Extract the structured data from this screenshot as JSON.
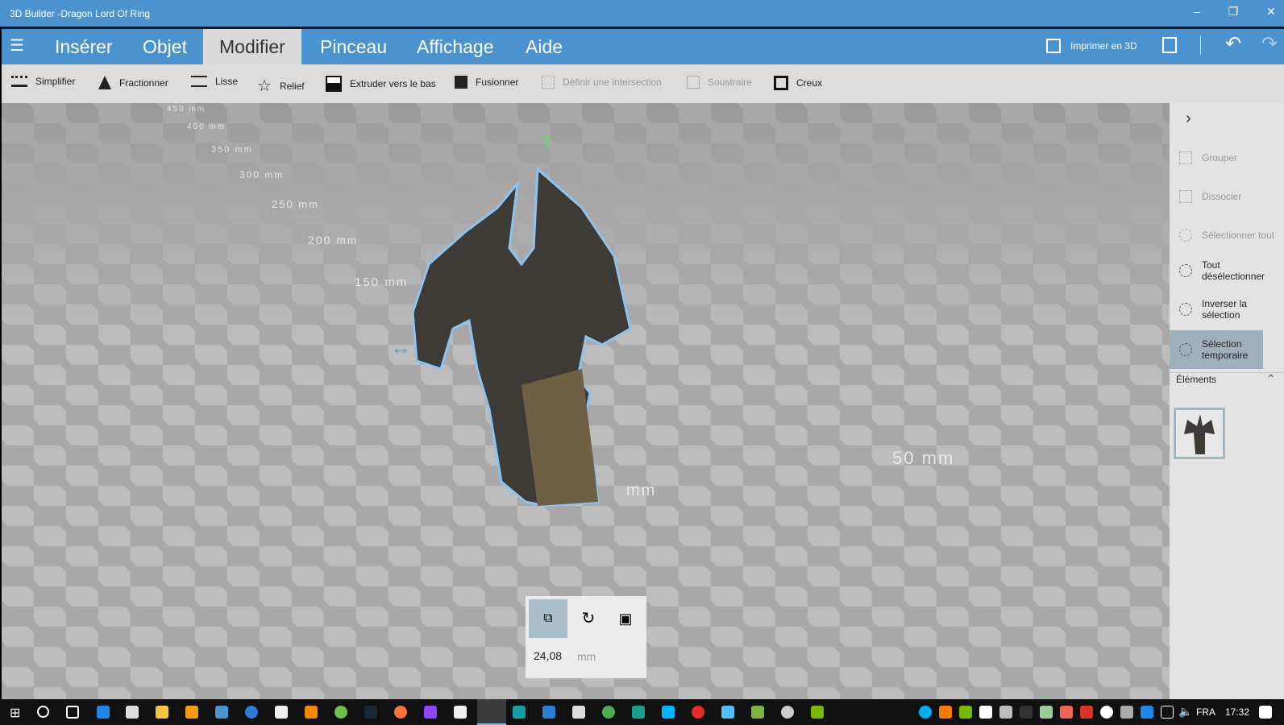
{
  "window": {
    "title": "3D Builder -Dragon Lord Of Ring",
    "minimize_icon": "minimize-icon",
    "restore_icon": "restore-icon",
    "close_icon": "close-icon"
  },
  "ribbon": {
    "tabs": [
      {
        "label": "Insérer"
      },
      {
        "label": "Objet"
      },
      {
        "label": "Modifier",
        "active": true
      },
      {
        "label": "Pinceau"
      },
      {
        "label": "Affichage"
      },
      {
        "label": "Aide"
      }
    ],
    "print_label": "Imprimer en 3D"
  },
  "toolbar": {
    "items": [
      {
        "label": "Simplifier",
        "enabled": true
      },
      {
        "label": "Fractionner",
        "enabled": true
      },
      {
        "label": "Lisse",
        "enabled": true
      },
      {
        "label": "Relief",
        "enabled": true
      },
      {
        "label": "Extruder vers le bas",
        "enabled": true
      },
      {
        "label": "Fusionner",
        "enabled": true
      },
      {
        "label": "Définir une intersection",
        "enabled": false
      },
      {
        "label": "Soustraire",
        "enabled": false
      },
      {
        "label": "Creux",
        "enabled": true
      }
    ]
  },
  "viewport": {
    "rulers": [
      "450 mm",
      "400 mm",
      "350 mm",
      "300 mm",
      "250 mm",
      "200 mm",
      "150 mm",
      "50 mm",
      "mm"
    ],
    "object": "Dragon Lord Of Ring"
  },
  "panel": {
    "items": [
      {
        "label": "Grouper",
        "enabled": false
      },
      {
        "label": "Dissocier",
        "enabled": false
      },
      {
        "label": "Sélectionner tout",
        "enabled": false
      },
      {
        "label": "Tout désélectionner",
        "enabled": true
      },
      {
        "label": "Inverser la sélection",
        "enabled": true
      },
      {
        "label": "Sélection temporaire",
        "enabled": true,
        "selected": true
      }
    ],
    "elements_label": "Éléments"
  },
  "scale": {
    "value": "24,08",
    "unit": "mm",
    "active_mode": "move"
  },
  "taskbar": {
    "lang": "FRA",
    "time": "17:32"
  },
  "colors": {
    "accent": "#4a93cf",
    "selection_outline": "#8cc4f0"
  }
}
